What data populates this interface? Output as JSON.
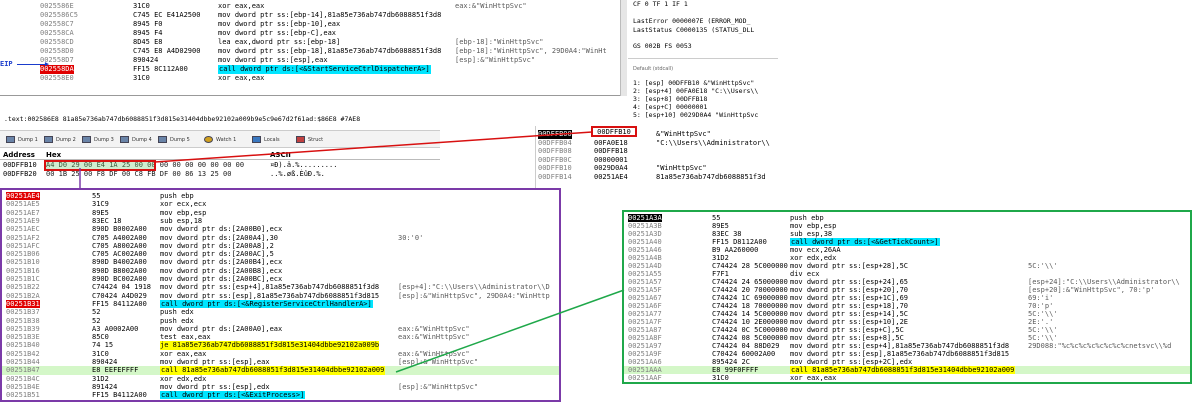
{
  "top_disasm": {
    "rows": [
      {
        "addr": "0025586E",
        "bytes": "31C0",
        "instr": "xor eax,eax",
        "comment": "eax:&\"WinHttpSvc\""
      },
      {
        "addr": "0025586C5",
        "bytes": "C745 EC E41A2500",
        "instr": "mov dword ptr ss:[ebp-14],81a85e736ab747db6088851f3d8",
        "comment": ""
      },
      {
        "addr": "002558C7",
        "bytes": "8945 F0",
        "instr": "mov dword ptr ss:[ebp-10],eax",
        "comment": ""
      },
      {
        "addr": "002558CA",
        "bytes": "8945 F4",
        "instr": "mov dword ptr ss:[ebp-C],eax",
        "comment": ""
      },
      {
        "addr": "002558CD",
        "bytes": "8D45 E8",
        "instr": "lea eax,dword ptr ss:[ebp-18]",
        "comment": "[ebp-18]:\"WinHttpSvc\""
      },
      {
        "addr": "002558D0",
        "bytes": "C745 E8 A4D02900",
        "instr": "mov dword ptr ss:[ebp-18],81a85e736ab747db6088851f3d8",
        "comment": "[ebp-18]:\"WinHttpSvc\", 29D0A4:\"WinHt"
      },
      {
        "addr": "002558D7",
        "bytes": "890424",
        "instr": "mov dword ptr ss:[esp],eax",
        "comment": "[esp]:&\"WinHttpSvc\""
      },
      {
        "addr": "002558DA",
        "bytes": "FF15 8C112A00",
        "instr": "call dword ptr ds:[<&StartServiceCtrlDispatcherA>]",
        "comment": ""
      },
      {
        "addr": "002558E0",
        "bytes": "31C0",
        "instr": "xor eax,eax",
        "comment": ""
      }
    ],
    "eip_label": "EIP",
    "status_line": ".text:002586E8 81a85e736ab747db6088851f3d815e31404dbbe92102a009b9e5c9e67d2f61ad:$86E8 #7AE8"
  },
  "registers": {
    "flags": "CF 0  TF 1  IF 1",
    "last_error": "LastError  0000007E (ERROR_MOD_",
    "last_status": "LastStatus C0000135 (STATUS_DLL",
    "segments": "GS 002B  FS 0053"
  },
  "call_stack": {
    "header": "Default (stdcall)",
    "rows": [
      "1: [esp] 00DFFB10 &\"WinHttpSvc\"",
      "2: [esp+4] 00FA0E18 \"C:\\\\Users\\\\",
      "3: [esp+8] 00DFFB18",
      "4: [esp+C] 00000001",
      "5: [esp+10] 0029D0A4 \"WinHttpSvc"
    ]
  },
  "toolbar": {
    "dumps": [
      "Dump 1",
      "Dump 2",
      "Dump 3",
      "Dump 4",
      "Dump 5",
      "Watch 1",
      "Locals",
      "Struct"
    ]
  },
  "dump": {
    "headers": {
      "address": "Address",
      "hex": "Hex",
      "ascii": "ASCII"
    },
    "rows": [
      {
        "addr": "00DFFB10",
        "hex": "A4 D0 29 00 E4 1A 25 00 00 00 00 00 00 00 00 00",
        "ascii": "¤Ð).ä.%........."
      },
      {
        "addr": "00DFFB20",
        "hex": "00 1B 25 00 F8 DF 00 C8 FB DF 00 86 13 25 00",
        "ascii": "..%.øß.ÈûÐ.%."
      }
    ],
    "selected": "A4 D0 29 00 E4 1A 25 00"
  },
  "stack": {
    "selected_addr": "00DFFB10",
    "selected_label": "00DFFB10",
    "rows": [
      {
        "addr": "00DFFB00",
        "val": "00DFFB10",
        "comment": "&\"WinHttpSvc\""
      },
      {
        "addr": "00DFFB04",
        "val": "00FA0E18",
        "comment": "\"C:\\\\Users\\\\Administrator\\\\"
      },
      {
        "addr": "00DFFB08",
        "val": "00DFFB18",
        "comment": ""
      },
      {
        "addr": "00DFFB0C",
        "val": "00000001",
        "comment": ""
      },
      {
        "addr": "00DFFB10",
        "val": "0029D0A4",
        "comment": "\"WinHttpSvc\""
      },
      {
        "addr": "00DFFB14",
        "val": "00251AE4",
        "comment": "81a85e736ab747db6088851f3d"
      }
    ]
  },
  "purple_disasm": {
    "rows": [
      {
        "addr": "00251AE4",
        "bytes": "55",
        "instr": "push ebp",
        "comment": "",
        "hl": "red"
      },
      {
        "addr": "00251AE5",
        "bytes": "31C9",
        "instr": "xor ecx,ecx",
        "comment": ""
      },
      {
        "addr": "00251AE7",
        "bytes": "89E5",
        "instr": "mov ebp,esp",
        "comment": ""
      },
      {
        "addr": "00251AE9",
        "bytes": "83EC 18",
        "instr": "sub esp,18",
        "comment": ""
      },
      {
        "addr": "00251AEC",
        "bytes": "890D B0002A00",
        "instr": "mov dword ptr ds:[2A00B0],ecx",
        "comment": ""
      },
      {
        "addr": "00251AF2",
        "bytes": "C705 A4002A00",
        "instr": "mov dword ptr ds:[2A00A4],30",
        "comment": "30:'0'"
      },
      {
        "addr": "00251AFC",
        "bytes": "C705 A8002A00",
        "instr": "mov dword ptr ds:[2A00A8],2",
        "comment": ""
      },
      {
        "addr": "00251B06",
        "bytes": "C705 AC002A00",
        "instr": "mov dword ptr ds:[2A00AC],5",
        "comment": ""
      },
      {
        "addr": "00251B10",
        "bytes": "890D B4002A00",
        "instr": "mov dword ptr ds:[2A00B4],ecx",
        "comment": ""
      },
      {
        "addr": "00251B16",
        "bytes": "890D B8002A00",
        "instr": "mov dword ptr ds:[2A00B8],ecx",
        "comment": ""
      },
      {
        "addr": "00251B1C",
        "bytes": "890D BC002A00",
        "instr": "mov dword ptr ds:[2A00BC],ecx",
        "comment": ""
      },
      {
        "addr": "00251B22",
        "bytes": "C74424 04 1918",
        "instr": "mov dword ptr ss:[esp+4],81a85e736ab747db6088851f3d8",
        "comment": "[esp+4]:\"C:\\\\Users\\\\Administrator\\\\D"
      },
      {
        "addr": "00251B2A",
        "bytes": "C70424 A4D029",
        "instr": "mov dword ptr ss:[esp],81a85e736ab747db6088851f3d815",
        "comment": "[esp]:&\"WinHttpSvc\", 29D0A4:\"WinHttp"
      },
      {
        "addr": "00251B31",
        "bytes": "FF15 84112A00",
        "instr": "call dword ptr ds:[<&RegisterServiceCtrlHandlerA>]",
        "comment": "",
        "hl": "redaddr"
      },
      {
        "addr": "00251B37",
        "bytes": "52",
        "instr": "push edx",
        "comment": ""
      },
      {
        "addr": "00251B38",
        "bytes": "52",
        "instr": "push edx",
        "comment": ""
      },
      {
        "addr": "00251B39",
        "bytes": "A3 A0002A00",
        "instr": "mov dword ptr ds:[2A00A0],eax",
        "comment": "eax:&\"WinHttpSvc\""
      },
      {
        "addr": "00251B3E",
        "bytes": "85C0",
        "instr": "test eax,eax",
        "comment": "eax:&\"WinHttpSvc\""
      },
      {
        "addr": "00251B40",
        "bytes": "74 15",
        "instr": "je 81a85e736ab747db6088851f3d815e31404dbbe92102a009b",
        "comment": "",
        "hl": "je"
      },
      {
        "addr": "00251B42",
        "bytes": "31C0",
        "instr": "xor eax,eax",
        "comment": "eax:&\"WinHttpSvc\""
      },
      {
        "addr": "00251B44",
        "bytes": "890424",
        "instr": "mov dword ptr ss:[esp],eax",
        "comment": "[esp]:&\"WinHttpSvc\""
      },
      {
        "addr": "00251B47",
        "bytes": "E8 EEFEFFFF",
        "instr": "call 81a85e736ab747db6088851f3d815e31404dbbe92102a009",
        "comment": "",
        "hl": "call"
      },
      {
        "addr": "00251B4C",
        "bytes": "31D2",
        "instr": "xor edx,edx",
        "comment": ""
      },
      {
        "addr": "00251B4E",
        "bytes": "891424",
        "instr": "mov dword ptr ss:[esp],edx",
        "comment": "[esp]:&\"WinHttpSvc\""
      },
      {
        "addr": "00251B51",
        "bytes": "FF15 B4112A00",
        "instr": "call dword ptr ds:[<&ExitProcess>]",
        "comment": ""
      }
    ]
  },
  "green_disasm": {
    "rows": [
      {
        "addr": "00251A3A",
        "bytes": "55",
        "instr": "push ebp",
        "comment": "",
        "hl": "black"
      },
      {
        "addr": "00251A3B",
        "bytes": "89E5",
        "instr": "mov ebp,esp",
        "comment": ""
      },
      {
        "addr": "00251A3D",
        "bytes": "83EC 38",
        "instr": "sub esp,38",
        "comment": ""
      },
      {
        "addr": "00251A40",
        "bytes": "FF15 D8112A00",
        "instr": "call dword ptr ds:[<&GetTickCount>]",
        "comment": ""
      },
      {
        "addr": "00251A46",
        "bytes": "B9 AA260000",
        "instr": "mov ecx,26AA",
        "comment": ""
      },
      {
        "addr": "00251A4B",
        "bytes": "31D2",
        "instr": "xor edx,edx",
        "comment": ""
      },
      {
        "addr": "00251A4D",
        "bytes": "C74424 28 5C000000",
        "instr": "mov dword ptr ss:[esp+28],5C",
        "comment": "5C:'\\\\'"
      },
      {
        "addr": "00251A55",
        "bytes": "F7F1",
        "instr": "div ecx",
        "comment": ""
      },
      {
        "addr": "00251A57",
        "bytes": "C74424 24 65000000",
        "instr": "mov dword ptr ss:[esp+24],65",
        "comment": "[esp+24]:\"C:\\\\Users\\\\Administrator\\\\"
      },
      {
        "addr": "00251A5F",
        "bytes": "C74424 20 70000000",
        "instr": "mov dword ptr ss:[esp+20],70",
        "comment": "[esp+20]:&\"WinHttpSvc\", 70:'p'"
      },
      {
        "addr": "00251A67",
        "bytes": "C74424 1C 69000000",
        "instr": "mov dword ptr ss:[esp+1C],69",
        "comment": "69:'i'"
      },
      {
        "addr": "00251A6F",
        "bytes": "C74424 18 70000000",
        "instr": "mov dword ptr ss:[esp+18],70",
        "comment": "70:'p'"
      },
      {
        "addr": "00251A77",
        "bytes": "C74424 14 5C000000",
        "instr": "mov dword ptr ss:[esp+14],5C",
        "comment": "5C:'\\\\'"
      },
      {
        "addr": "00251A7F",
        "bytes": "C74424 10 2E000000",
        "instr": "mov dword ptr ss:[esp+10],2E",
        "comment": "2E:'.'"
      },
      {
        "addr": "00251A87",
        "bytes": "C74424 0C 5C000000",
        "instr": "mov dword ptr ss:[esp+C],5C",
        "comment": "5C:'\\\\'"
      },
      {
        "addr": "00251A8F",
        "bytes": "C74424 08 5C000000",
        "instr": "mov dword ptr ss:[esp+8],5C",
        "comment": "5C:'\\\\'"
      },
      {
        "addr": "00251A97",
        "bytes": "C74424 04 88D029",
        "instr": "mov dword ptr ss:[esp+4],81a85e736ab747db6088851f3d8",
        "comment": "29D088:\"%c%c%c%c%c%c%c%cnetsvc\\\\%d"
      },
      {
        "addr": "00251A9F",
        "bytes": "C70424 60002A00",
        "instr": "mov dword ptr ss:[esp],81a85e736ab747db6088851f3d815",
        "comment": ""
      },
      {
        "addr": "00251AA6",
        "bytes": "895424 2C",
        "instr": "mov dword ptr ss:[esp+2C],edx",
        "comment": ""
      },
      {
        "addr": "00251AAA",
        "bytes": "E8 99F0FFFF",
        "instr": "call 81a85e736ab747db6088851f3d815e31404dbbe92102a009",
        "comment": "",
        "hl": "call"
      },
      {
        "addr": "00251AAF",
        "bytes": "31C0",
        "instr": "xor eax,eax",
        "comment": ""
      }
    ]
  },
  "colors": {
    "purple_frame": "#7b3aa8",
    "green_frame": "#1fa84a",
    "red_frame": "#d81010",
    "call_bg": "#00e5ff",
    "jump_bg": "#ffff00"
  }
}
